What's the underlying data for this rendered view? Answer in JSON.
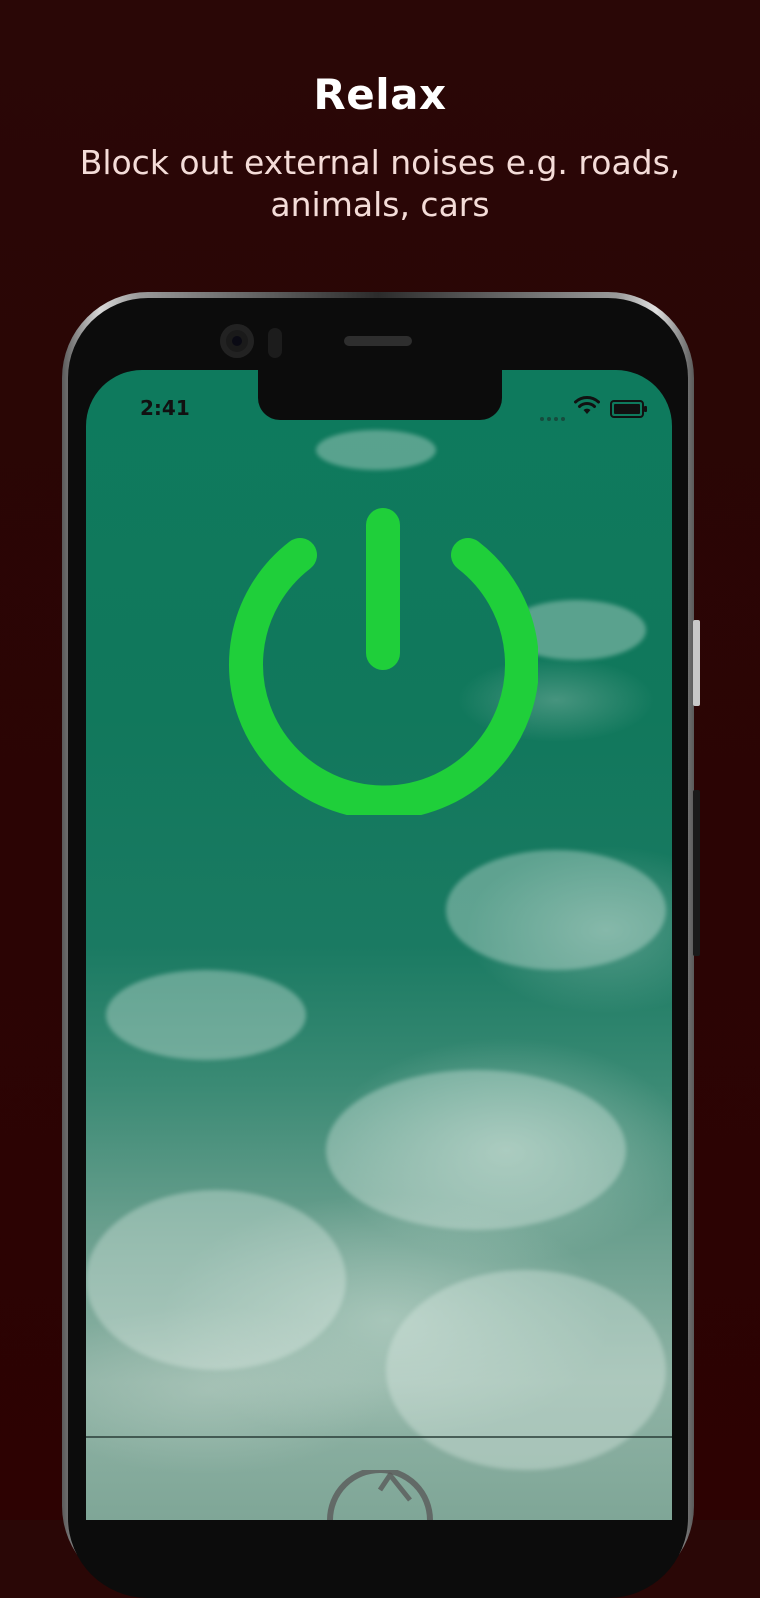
{
  "header": {
    "title": "Relax",
    "subtitle_line1": "Block out external noises e.g. roads,",
    "subtitle_line2": "animals, cars"
  },
  "phone": {
    "status_bar": {
      "time": "2:41",
      "icons": [
        "signal-dots-icon",
        "wifi-icon",
        "battery-icon"
      ]
    },
    "main": {
      "power_button": {
        "icon": "power-icon",
        "color": "#1fcf3a",
        "state": "on"
      },
      "background": "ocean-waves-aerial"
    },
    "bottom_bar": {
      "icon": "timer-icon"
    }
  },
  "colors": {
    "page_background": "#2b0404",
    "title": "#ffffff",
    "subtitle": "#f4dcd8",
    "power_icon": "#1fcf3a"
  }
}
